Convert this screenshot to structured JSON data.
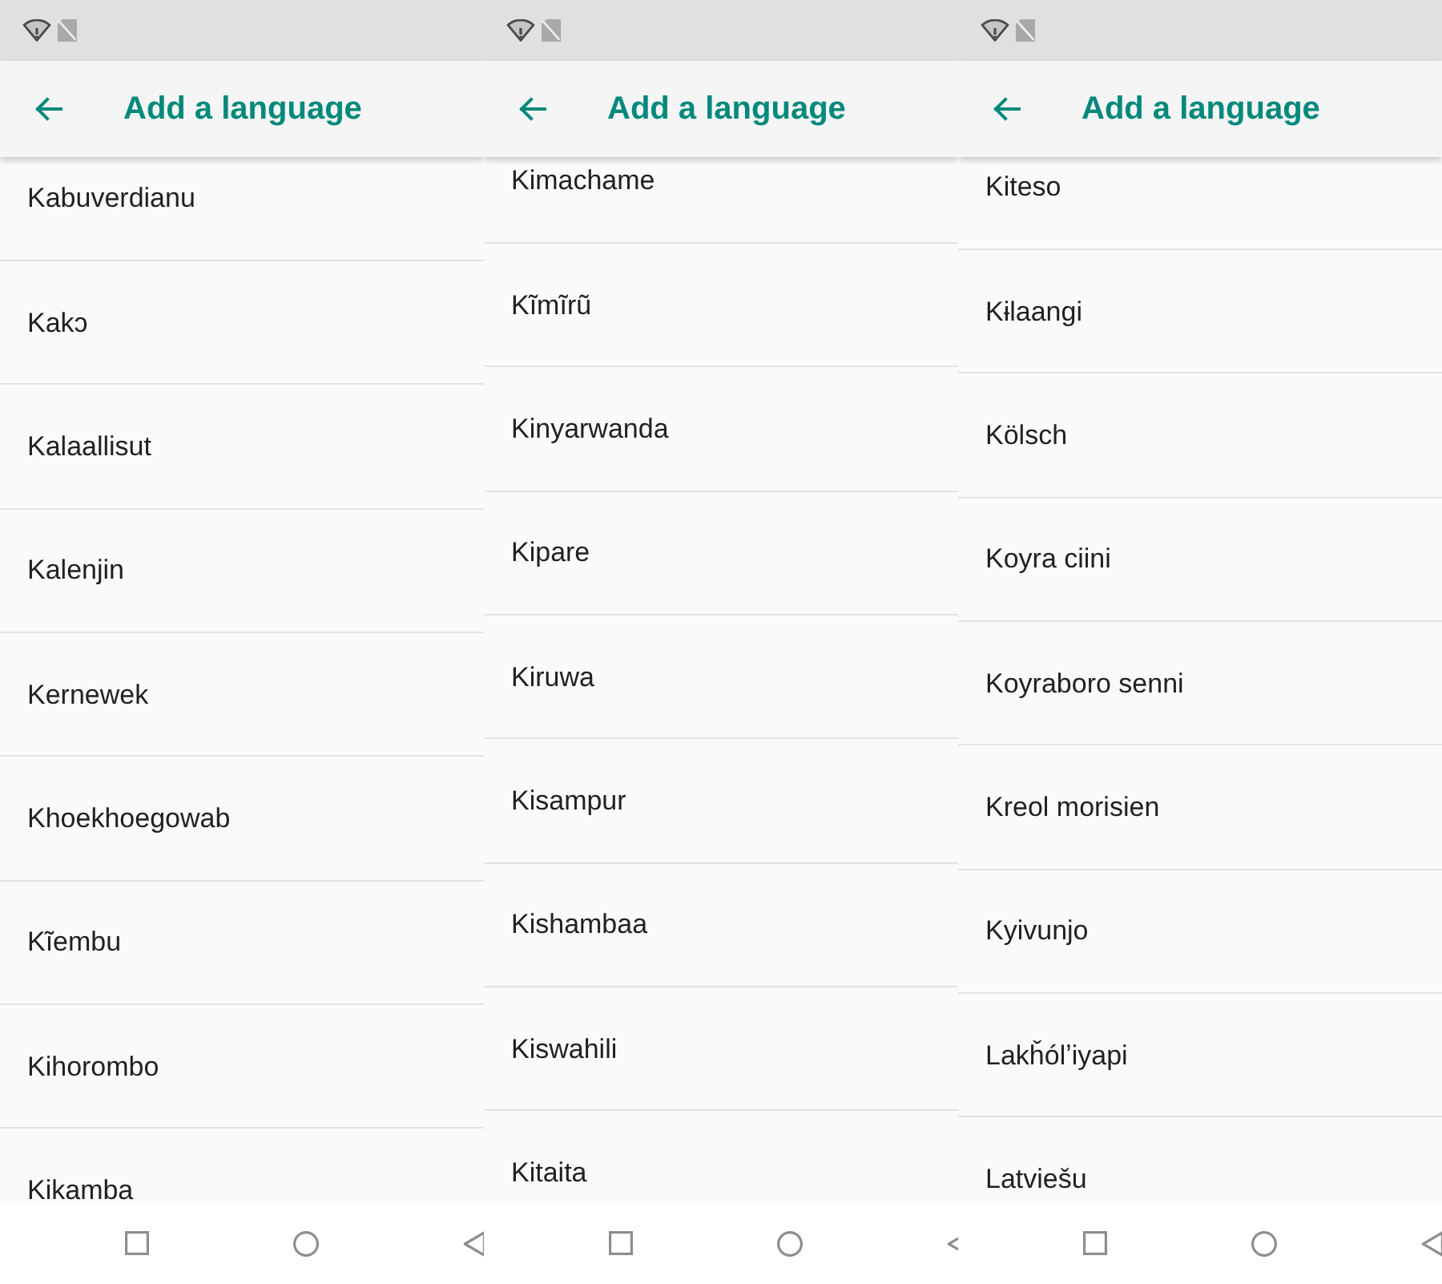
{
  "screens": [
    {
      "title": "Add a language",
      "languages": [
        "Kabuverdianu",
        "Kakɔ",
        "Kalaallisut",
        "Kalenjin",
        "Kernewek",
        "Khoekhoegowab",
        "Kĩembu",
        "Kihorombo",
        "Kikamba"
      ]
    },
    {
      "title": "Add a language",
      "languages": [
        "Kimachame",
        "Kĩmĩrũ",
        "Kinyarwanda",
        "Kipare",
        "Kiruwa",
        "Kisampur",
        "Kishambaa",
        "Kiswahili",
        "Kitaita"
      ]
    },
    {
      "title": "Add a language",
      "languages": [
        "Kiteso",
        "Kɨlaangi",
        "Kölsch",
        "Koyra ciini",
        "Koyraboro senni",
        "Kreol morisien",
        "Kyivunjo",
        "Lakȟólʼiyapi",
        "Latviešu"
      ]
    }
  ]
}
